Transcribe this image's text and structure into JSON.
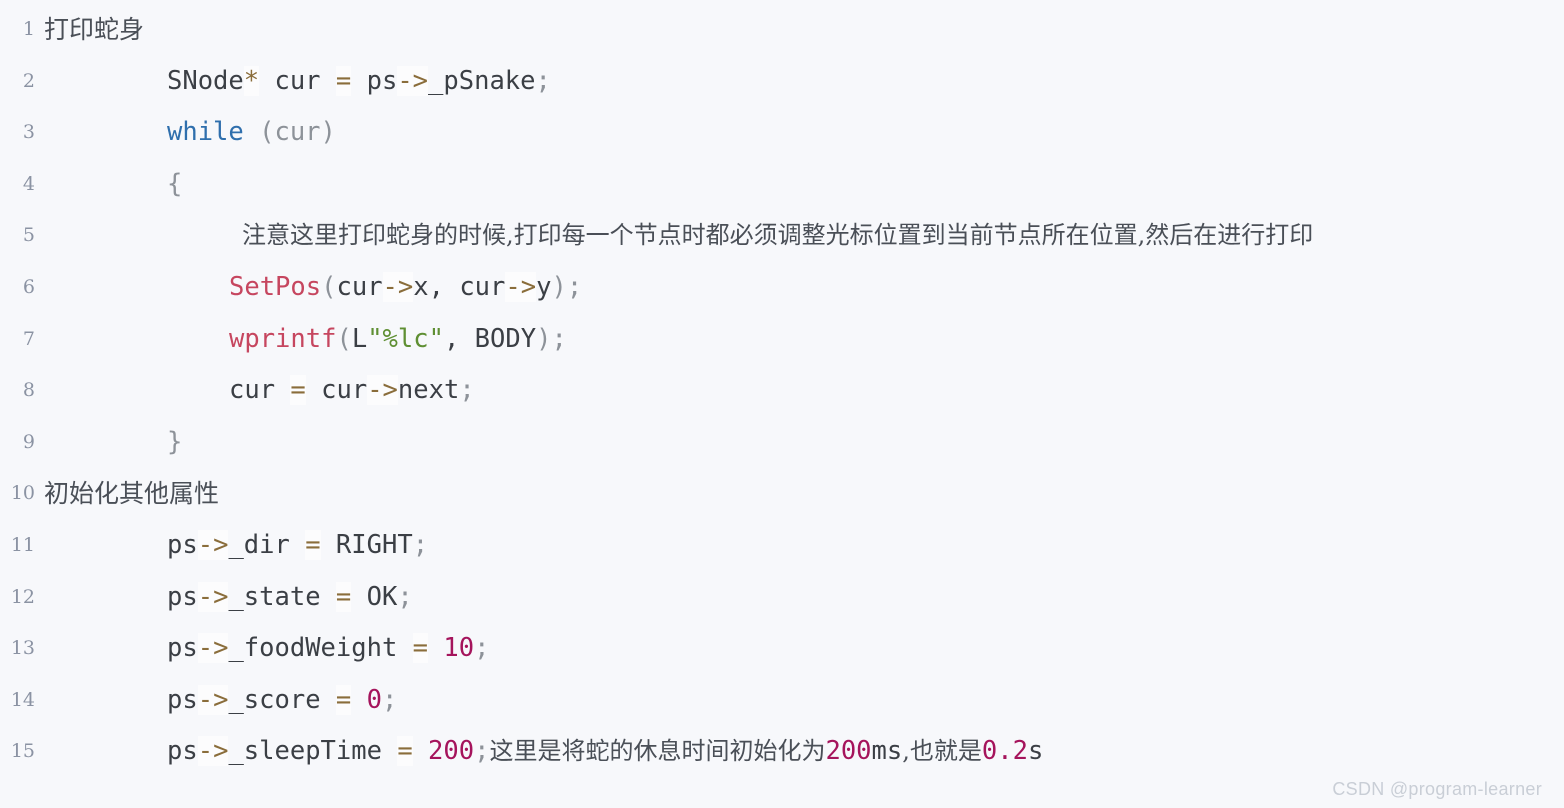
{
  "code_block": {
    "language": "c",
    "background_color": "#f7f8fb",
    "gutter_color": "#8b93a3",
    "colors": {
      "plain": "#3b3f45",
      "keyword": "#2f6fad",
      "function": "#c6465f",
      "string": "#5f8f33",
      "number": "#a5145c",
      "operator": "#8a6d3b",
      "punctuation": "#8d9299",
      "chinese_text": "#4a4f57"
    },
    "line_numbers": [
      "1",
      "2",
      "3",
      "4",
      "5",
      "6",
      "7",
      "8",
      "9",
      "10",
      "11",
      "12",
      "13",
      "14",
      "15"
    ],
    "lines": [
      {
        "n": "1",
        "indent": "none",
        "text": "打印蛇身"
      },
      {
        "n": "2",
        "indent": "code",
        "text": "SNode* cur = ps->_pSnake;"
      },
      {
        "n": "3",
        "indent": "code",
        "text": "while (cur)"
      },
      {
        "n": "4",
        "indent": "code",
        "text": "{"
      },
      {
        "n": "5",
        "indent": "comment",
        "text": "注意这里打印蛇身的时候,打印每一个节点时都必须调整光标位置到当前节点所在位置,然后在进行打印"
      },
      {
        "n": "6",
        "indent": "code2",
        "text": "SetPos(cur->x, cur->y);"
      },
      {
        "n": "7",
        "indent": "code2",
        "text": "wprintf(L\"%lc\", BODY);"
      },
      {
        "n": "8",
        "indent": "code2",
        "text": "cur = cur->next;"
      },
      {
        "n": "9",
        "indent": "code",
        "text": "}"
      },
      {
        "n": "10",
        "indent": "none",
        "text": "初始化其他属性"
      },
      {
        "n": "11",
        "indent": "code",
        "text": "ps->_dir = RIGHT;"
      },
      {
        "n": "12",
        "indent": "code",
        "text": "ps->_state = OK;"
      },
      {
        "n": "13",
        "indent": "code",
        "text": "ps->_foodWeight = 10;"
      },
      {
        "n": "14",
        "indent": "code",
        "text": "ps->_score = 0;"
      },
      {
        "n": "15",
        "indent": "code",
        "text": "ps->_sleepTime = 200;这里是将蛇的休息时间初始化为200ms,也就是0.2s"
      }
    ],
    "tokens": {
      "l1_cn": "打印蛇身",
      "l2_type": "SNode",
      "l2_star": "*",
      "l2_cur": " cur ",
      "l2_eq": "=",
      "l2_ps": " ps",
      "l2_arrow": "->",
      "l2_member": "_pSnake",
      "l2_semi": ";",
      "l3_kw": "while",
      "l3_rest": " (cur)",
      "l4_brace": "{",
      "l5_cn": "注意这里打印蛇身的时候,打印每一个节点时都必须调整光标位置到当前节点所在位置,然后在进行打印",
      "l6_fn": "SetPos",
      "l6_p1": "(",
      "l6_a1": "cur",
      "l6_arrow1": "->",
      "l6_x": "x, cur",
      "l6_arrow2": "->",
      "l6_y": "y",
      "l6_p2": ")",
      "l6_semi": ";",
      "l7_fn": "wprintf",
      "l7_p1": "(",
      "l7_L": "L",
      "l7_str": "\"%lc\"",
      "l7_mid": ", BODY",
      "l7_p2": ")",
      "l7_semi": ";",
      "l8_cur": "cur ",
      "l8_eq": "=",
      "l8_mid": " cur",
      "l8_arrow": "->",
      "l8_next": "next",
      "l8_semi": ";",
      "l9_brace": "}",
      "l10_cn": "初始化其他属性",
      "l11_ps": "ps",
      "l11_arrow": "->",
      "l11_member": "_dir ",
      "l11_eq": "=",
      "l11_val": " RIGHT",
      "l11_semi": ";",
      "l12_ps": "ps",
      "l12_arrow": "->",
      "l12_member": "_state ",
      "l12_eq": "=",
      "l12_val": " OK",
      "l12_semi": ";",
      "l13_ps": "ps",
      "l13_arrow": "->",
      "l13_member": "_foodWeight ",
      "l13_eq": "=",
      "l13_num": " 10",
      "l13_semi": ";",
      "l14_ps": "ps",
      "l14_arrow": "->",
      "l14_member": "_score ",
      "l14_eq": "=",
      "l14_num": " 0",
      "l14_semi": ";",
      "l15_ps": "ps",
      "l15_arrow": "->",
      "l15_member": "_sleepTime ",
      "l15_eq": "=",
      "l15_num": " 200",
      "l15_semi": ";",
      "l15_cn1": "这里是将蛇的休息时间初始化为",
      "l15_num2": "200",
      "l15_unit1": "ms",
      "l15_cn2": ",也就是",
      "l15_num3": "0.2",
      "l15_unit2": "s"
    }
  },
  "watermark": {
    "text": "CSDN @program-learner"
  }
}
